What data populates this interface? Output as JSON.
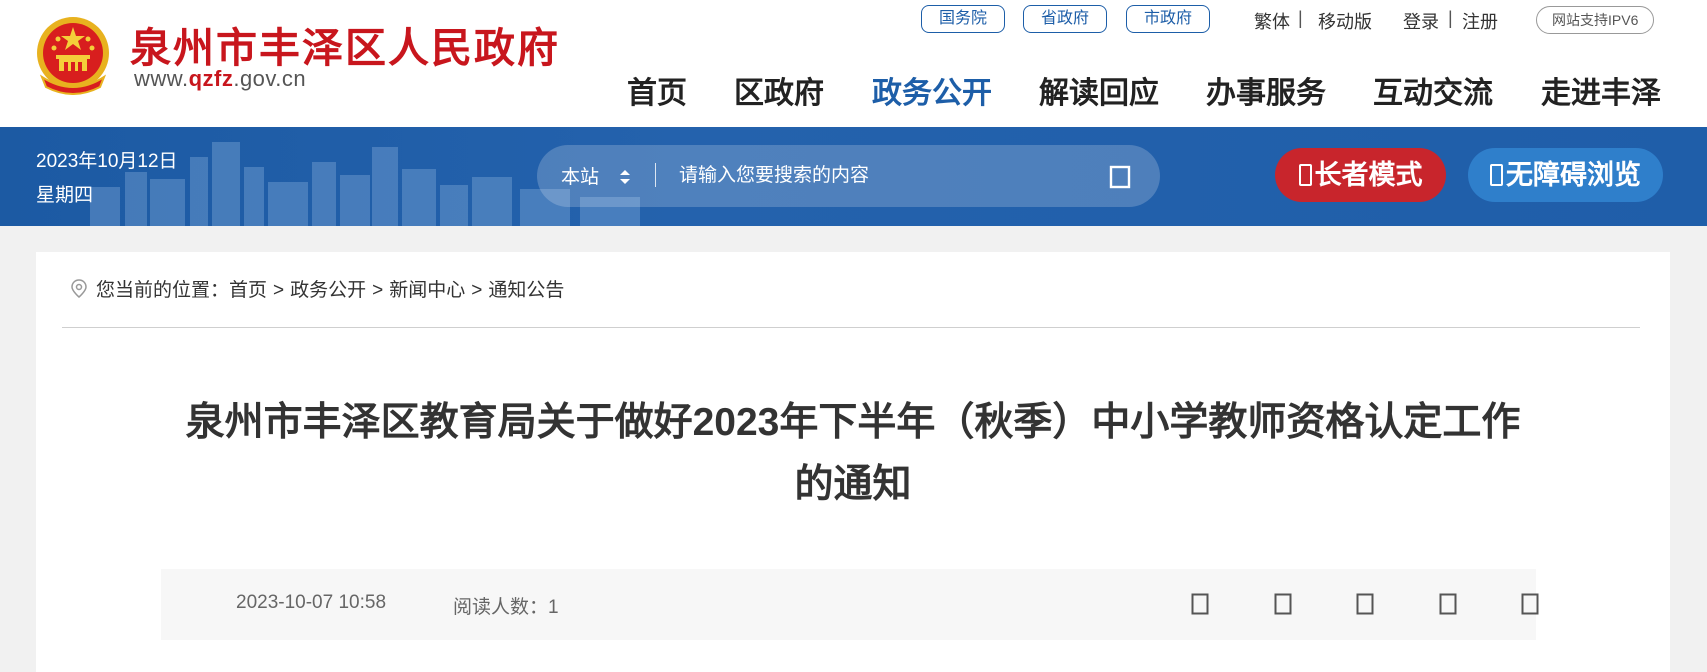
{
  "header": {
    "site_name": "泉州市丰泽区人民政府",
    "site_url_prefix": "www.",
    "site_url_highlight": "qzfz",
    "site_url_suffix": ".gov.cn",
    "gov_links": [
      "国务院",
      "省政府",
      "市政府"
    ],
    "top_links": {
      "traditional": "繁体",
      "mobile": "移动版",
      "login": "登录",
      "register": "注册"
    },
    "ipv6_badge": "网站支持IPV6",
    "nav": [
      {
        "label": "首页",
        "active": false
      },
      {
        "label": "区政府",
        "active": false
      },
      {
        "label": "政务公开",
        "active": true
      },
      {
        "label": "解读回应",
        "active": false
      },
      {
        "label": "办事服务",
        "active": false
      },
      {
        "label": "互动交流",
        "active": false
      },
      {
        "label": "走进丰泽",
        "active": false
      }
    ],
    "brand_red": "#c8161d",
    "brand_blue": "#1d5ea8"
  },
  "bluebar": {
    "date": "2023年10月12日",
    "weekday": "星期四",
    "search": {
      "scope": "本站",
      "placeholder": "请输入您要搜索的内容",
      "button_icon": "search-icon"
    },
    "elder_mode_label": "长者模式",
    "accessibility_label": "无障碍浏览"
  },
  "breadcrumb": {
    "prefix": "您当前的位置：",
    "items": [
      "首页",
      "政务公开",
      "新闻中心",
      "通知公告"
    ]
  },
  "article": {
    "title": "泉州市丰泽区教育局关于做好2023年下半年（秋季）中小学教师资格认定工作的通知",
    "published": "2023-10-07 10:58",
    "reads_label": "阅读人数：",
    "reads_count": "1",
    "share_icons": [
      "share-icon-1",
      "share-icon-2",
      "share-icon-3",
      "share-icon-4",
      "share-icon-5"
    ]
  }
}
